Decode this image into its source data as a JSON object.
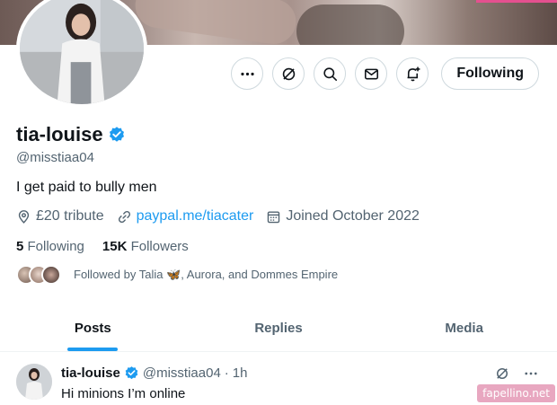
{
  "profile": {
    "display_name": "tia-louise",
    "handle": "@misstiaa04",
    "bio": "I get paid to bully men",
    "location": "£20 tribute",
    "website": "paypal.me/tiacater",
    "joined": "Joined October 2022",
    "following_count": "5",
    "following_label": "Following",
    "followers_count": "15K",
    "followers_label": "Followers",
    "followed_by": "Followed by Talia 🦋, Aurora, and Dommes Empire"
  },
  "actions": {
    "following_button": "Following",
    "icons": [
      "more-icon",
      "grok-icon",
      "search-icon",
      "message-icon",
      "notification-add-icon"
    ]
  },
  "tabs": [
    {
      "label": "Posts",
      "active": true
    },
    {
      "label": "Replies",
      "active": false
    },
    {
      "label": "Media",
      "active": false
    }
  ],
  "tweet": {
    "name": "tia-louise",
    "handle": "@misstiaa04",
    "separator": "·",
    "time": "1h",
    "text": "Hi minions I’m online"
  },
  "watermark": "fapellino.net",
  "colors": {
    "accent": "#1d9bf0",
    "text": "#0f1419",
    "secondary": "#536471"
  }
}
